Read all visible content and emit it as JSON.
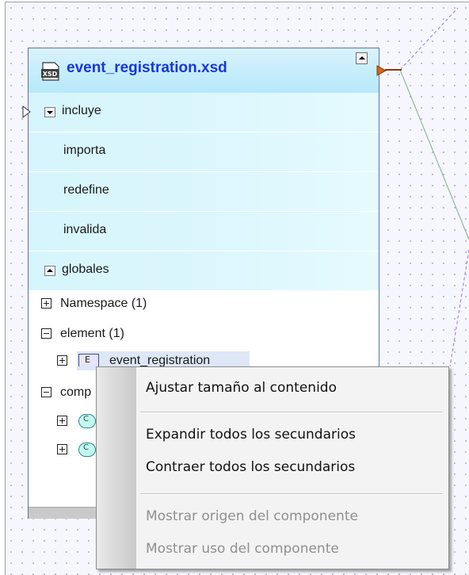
{
  "schema_box": {
    "title": "event_registration.xsd",
    "icon": "xsd-file-icon",
    "sections": {
      "includes": "incluye",
      "imports": "importa",
      "redefines": "redefine",
      "overrides": "invalida",
      "globals": "globales"
    },
    "tree": {
      "namespace": "Namespace (1)",
      "element": "element (1)",
      "element_child": "event_registration",
      "complex_prefix": "comp"
    }
  },
  "context_menu": {
    "items": [
      {
        "label": "Ajustar tamaño al contenido",
        "enabled": true
      },
      {
        "label": "Expandir todos los secundarios",
        "enabled": true
      },
      {
        "label": "Contraer todos los secundarios",
        "enabled": true
      },
      {
        "label": "Mostrar origen del componente",
        "enabled": false
      },
      {
        "label": "Mostrar uso del componente",
        "enabled": false
      }
    ]
  },
  "colors": {
    "title_text": "#1737d8",
    "header_bg": "#b6e8fa",
    "connector": "#d2691e",
    "link_green": "#7fb07f",
    "link_purple": "#a070d8"
  }
}
